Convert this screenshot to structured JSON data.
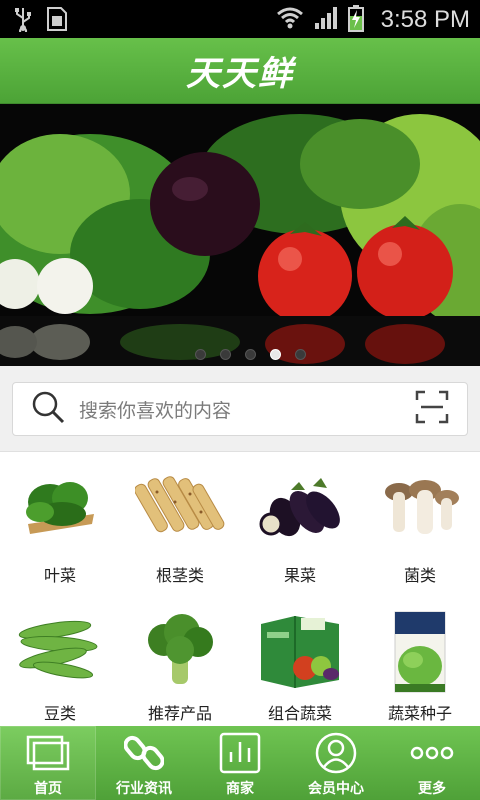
{
  "status_bar": {
    "time": "3:58 PM"
  },
  "header": {
    "title": "天天鲜"
  },
  "banner": {
    "slide_count": 5,
    "active_slide": 4
  },
  "search": {
    "placeholder": "搜索你喜欢的内容"
  },
  "categories": [
    {
      "label": "叶菜",
      "icon": "leafy-vegetable-icon"
    },
    {
      "label": "根茎类",
      "icon": "root-vegetable-icon"
    },
    {
      "label": "果菜",
      "icon": "eggplant-icon"
    },
    {
      "label": "菌类",
      "icon": "mushroom-icon"
    },
    {
      "label": "豆类",
      "icon": "bean-pod-icon"
    },
    {
      "label": "推荐产品",
      "icon": "broccoli-icon"
    },
    {
      "label": "组合蔬菜",
      "icon": "vegetable-gift-box-icon"
    },
    {
      "label": "蔬菜种子",
      "icon": "seed-packet-icon"
    }
  ],
  "tab_bar": {
    "items": [
      {
        "label": "首页",
        "icon": "home-icon",
        "active": true
      },
      {
        "label": "行业资讯",
        "icon": "link-icon",
        "active": false
      },
      {
        "label": "商家",
        "icon": "merchant-icon",
        "active": false
      },
      {
        "label": "会员中心",
        "icon": "member-icon",
        "active": false
      },
      {
        "label": "更多",
        "icon": "more-icon",
        "active": false
      }
    ]
  },
  "colors": {
    "brand_green": "#5bb341",
    "status_bar": "#000000",
    "search_bg": "#f0f0f0"
  }
}
